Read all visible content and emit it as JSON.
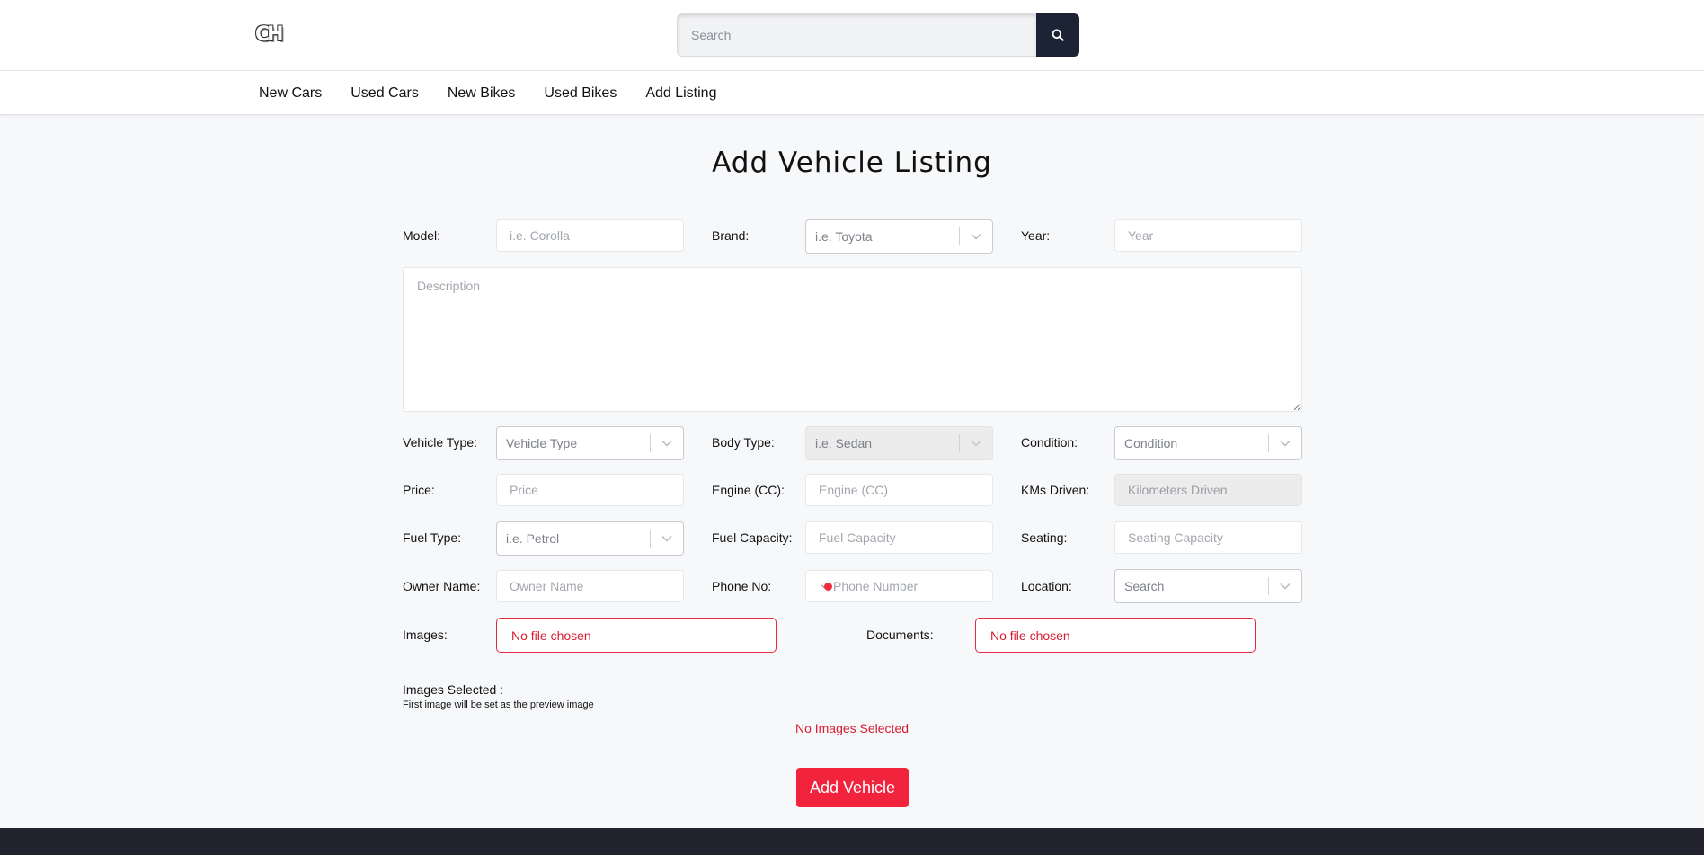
{
  "header": {
    "logo": "CH",
    "search_placeholder": "Search"
  },
  "nav": {
    "items": [
      "New Cars",
      "Used Cars",
      "New Bikes",
      "Used Bikes",
      "Add Listing"
    ]
  },
  "form": {
    "title": "Add Vehicle Listing",
    "model": {
      "label": "Model:",
      "placeholder": "i.e. Corolla"
    },
    "brand": {
      "label": "Brand:",
      "value": "i.e. Toyota"
    },
    "year": {
      "label": "Year:",
      "placeholder": "Year"
    },
    "description": {
      "placeholder": "Description"
    },
    "vehicle_type": {
      "label": "Vehicle Type:",
      "value": "Vehicle Type"
    },
    "body_type": {
      "label": "Body Type:",
      "value": "i.e. Sedan"
    },
    "condition": {
      "label": "Condition:",
      "value": "Condition"
    },
    "price": {
      "label": "Price:",
      "placeholder": "Price"
    },
    "engine": {
      "label": "Engine (CC):",
      "placeholder": "Engine (CC)"
    },
    "kms": {
      "label": "KMs Driven:",
      "placeholder": "Kilometers Driven"
    },
    "fuel_type": {
      "label": "Fuel Type:",
      "value": "i.e. Petrol"
    },
    "fuel_capacity": {
      "label": "Fuel Capacity:",
      "placeholder": "Fuel Capacity"
    },
    "seating": {
      "label": "Seating:",
      "placeholder": "Seating Capacity"
    },
    "owner": {
      "label": "Owner Name:",
      "placeholder": "Owner Name"
    },
    "phone": {
      "label": "Phone No:",
      "placeholder": "Phone Number"
    },
    "location": {
      "label": "Location:",
      "value": "Search"
    },
    "images": {
      "label": "Images:",
      "status": "No file chosen"
    },
    "documents": {
      "label": "Documents:",
      "status": "No file chosen"
    },
    "images_selected": "Images Selected :",
    "preview_note": "First image will be set as the preview image",
    "no_images": "No Images Selected",
    "submit_label": "Add Vehicle"
  },
  "colors": {
    "accent": "#f2233d",
    "search_button": "#1c2335",
    "footer": "#23232f"
  },
  "icons": {
    "search": "search-icon",
    "dropdown": "chevron-down-icon",
    "flag": "bangladesh-flag-icon"
  }
}
